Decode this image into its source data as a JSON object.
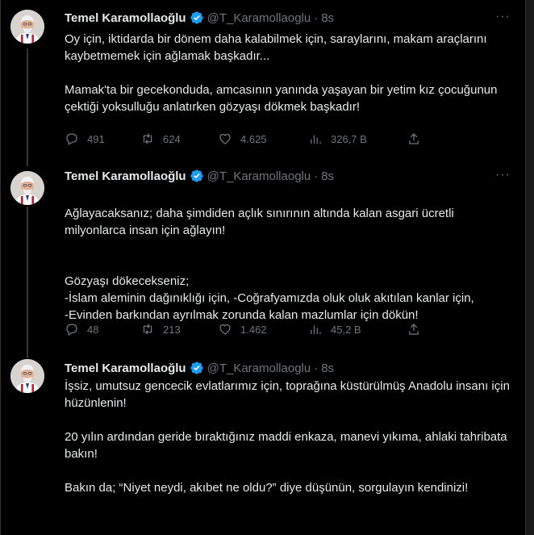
{
  "colors": {
    "background": "#000000",
    "text": "#e7e9ea",
    "muted": "#71767b",
    "verified": "#1d9bf0",
    "border": "#2f3336"
  },
  "author": {
    "name": "Temel Karamollaoğlu",
    "handle": "@T_Karamollaoglu",
    "time": "8s"
  },
  "more_label": "···",
  "tweets": [
    {
      "paragraphs": [
        "Oy için, iktidarda bir dönem daha kalabilmek için, saraylarını, makam araçlarını kaybetmemek için ağlamak başkadır...",
        "Mamak'ta bir gecekonduda, amcasının yanında yaşayan bir yetim kız çocuğunun çektiği yoksulluğu anlatırken gözyaşı dökmek başkadır!"
      ],
      "stats": {
        "replies": "491",
        "retweets": "624",
        "likes": "4.625",
        "views": "326,7 B"
      }
    },
    {
      "paragraphs": [
        "Ağlayacaksanız; daha şimdiden açlık sınırının altında kalan asgari ücretli milyonlarca insan için ağlayın!",
        "Gözyaşı dökecekseniz;\n-İslam aleminin dağınıklığı için, -Coğrafyamızda oluk oluk akıtılan kanlar için,\n-Evinden barkından ayrılmak zorunda kalan mazlumlar için dökün!"
      ],
      "stats": {
        "replies": "48",
        "retweets": "213",
        "likes": "1.462",
        "views": "45,2 B"
      }
    },
    {
      "paragraphs": [
        "İşsiz, umutsuz gencecik evlatlarımız için, toprağına küstürülmüş Anadolu insanı için hüzünlenin!",
        "20 yılın ardından geride bıraktığınız maddi enkaza, manevi yıkıma, ahlaki tahribata bakın!",
        "Bakın da; “Niyet neydi, akıbet ne oldu?” diye düşünün, sorgulayın kendinizi!"
      ]
    }
  ],
  "icons": {
    "reply": "reply-icon",
    "retweet": "retweet-icon",
    "like": "heart-icon",
    "views": "views-icon",
    "share": "share-icon",
    "verified": "verified-badge-icon",
    "more": "more-icon"
  }
}
